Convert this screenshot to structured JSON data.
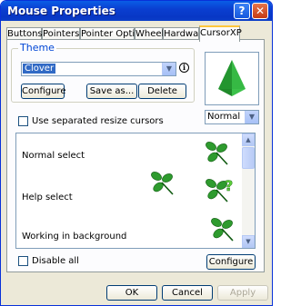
{
  "window": {
    "title": "Mouse Properties"
  },
  "titlebar_buttons": {
    "help": "?",
    "close": "✕"
  },
  "tabs": [
    {
      "label": "Buttons"
    },
    {
      "label": "Pointers"
    },
    {
      "label": "Pointer Options"
    },
    {
      "label": "Wheel"
    },
    {
      "label": "Hardware"
    },
    {
      "label": "CursorXP"
    }
  ],
  "theme": {
    "group_label": "Theme",
    "selected": "Clover",
    "info_glyph": "i",
    "buttons": {
      "configure": "Configure",
      "save_as": "Save as...",
      "delete": "Delete"
    }
  },
  "preview": {
    "size_selected": "Normal"
  },
  "resize_cursors": {
    "label": "Use separated resize cursors",
    "checked": false
  },
  "cursor_list": {
    "items": [
      {
        "label": "Normal select",
        "icon": "clover-arrow-icon"
      },
      {
        "label": "Help select",
        "icon": "clover-help-icon"
      },
      {
        "label": "Working in background",
        "icon": "clover-working-icon"
      }
    ]
  },
  "disable_all": {
    "label": "Disable all",
    "checked": false
  },
  "panel_configure": "Configure",
  "dialog_buttons": {
    "ok": "OK",
    "cancel": "Cancel",
    "apply": "Apply"
  },
  "colors": {
    "titlebar": "#0a3fd1",
    "accent_tab": "#ffc73c",
    "dialog_bg": "#ece9d8",
    "clover": "#2e9b2e"
  }
}
